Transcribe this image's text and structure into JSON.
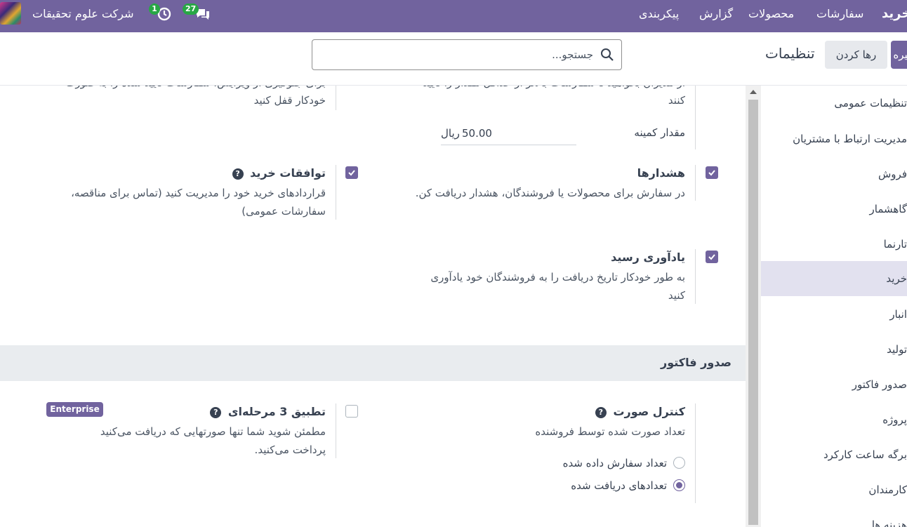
{
  "navbar": {
    "app_name": "خرید",
    "menu": [
      "سفارشات",
      "محصولات",
      "گزارش",
      "پیکربندی"
    ],
    "messages_count": "27",
    "activities_count": "1",
    "company": "شرکت علوم تحقیقات",
    "color": "#71639e"
  },
  "control": {
    "save_label": "ذخیره",
    "discard_label": "رها کردن",
    "title": "تنظیمات",
    "search_placeholder": "جستجو..."
  },
  "settings": {
    "top_left_desc_line1": "برای جلوگیری از ویرایش، سفارشات تأیید شده را به صورت",
    "top_left_desc_line2": "خودکار قفل کنید",
    "top_right_desc_line1": "از مدیران بخواهید تا سفارشات بالاتر از حداقل مقدار را تأیید",
    "top_right_desc_line2": "کنند",
    "min_amount_label": "مقدار کمینه",
    "min_amount_value": "50.00",
    "min_amount_currency": "ریال",
    "warnings_title": "هشدارها",
    "warnings_desc": "در سفارش برای محصولات یا فروشندگان، هشدار دریافت کن.",
    "agreements_title": "توافقات خرید",
    "agreements_desc_line1": "قراردادهای خرید خود را مدیریت کنید (تماس برای مناقصه،",
    "agreements_desc_line2": "سفارشات عمومی)",
    "receipt_title": "یادآوری رسید",
    "receipt_desc_line1": "به طور خودکار تاریخ دریافت را به فروشندگان خود یادآوری",
    "receipt_desc_line2": "کنید",
    "help_symbol": "?"
  },
  "invoicing": {
    "section_title": "صدور فاکتور",
    "bill_control_title": "کنترل صورت",
    "bill_control_desc": "تعداد صورت شده توسط فروشنده",
    "option_ordered": "تعداد سفارش داده شده",
    "option_received": "تعدادهای دریافت شده",
    "three_way_title": "تطبیق 3 مرحله‌ای",
    "three_way_desc_line1": "مطمئن شوید شما تنها صورتهایی که دریافت می‌کنید",
    "three_way_desc_line2": "پرداخت می‌کنید.",
    "enterprise_label": "Enterprise"
  },
  "sidebar": {
    "items": [
      "تنظیمات عمومی",
      "مدیریت ارتباط با مشتریان",
      "فروش",
      "گاهشمار",
      "تارنما",
      "خرید",
      "انبار",
      "تولید",
      "صدور فاکتور",
      "پروژه",
      "برگه ساعت کارکرد",
      "کارمندان",
      "هزینه ها"
    ],
    "active_index": 5
  }
}
